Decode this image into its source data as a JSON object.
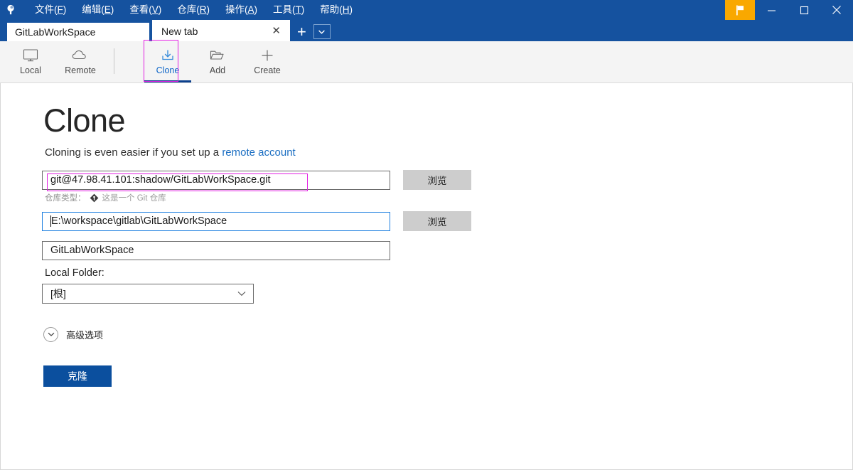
{
  "window": {
    "app_icon": "sourcetree-logo-icon",
    "flag_button_icon": "flag-icon",
    "minimize_label": "─",
    "maximize_label": "□",
    "close_label": "✕"
  },
  "menubar": {
    "items": [
      {
        "label": "文件(F)",
        "text": "文件",
        "accel": "F"
      },
      {
        "label": "编辑(E)",
        "text": "编辑",
        "accel": "E"
      },
      {
        "label": "查看(V)",
        "text": "查看",
        "accel": "V"
      },
      {
        "label": "仓库(R)",
        "text": "仓库",
        "accel": "R"
      },
      {
        "label": "操作(A)",
        "text": "操作",
        "accel": "A"
      },
      {
        "label": "工具(T)",
        "text": "工具",
        "accel": "T"
      },
      {
        "label": "帮助(H)",
        "text": "帮助",
        "accel": "H"
      }
    ]
  },
  "tabs": {
    "items": [
      {
        "label": "GitLabWorkSpace",
        "active": false
      },
      {
        "label": "New tab",
        "active": true,
        "close_label": "✕"
      }
    ],
    "new_tab_label": "+",
    "dropdown_icon": "chevron-down-icon"
  },
  "toolbar": {
    "buttons": [
      {
        "label": "Local",
        "icon": "monitor-icon",
        "active": false
      },
      {
        "label": "Remote",
        "icon": "cloud-icon",
        "active": false
      },
      {
        "label": "Clone",
        "icon": "clone-download-icon",
        "active": true,
        "highlighted": true
      },
      {
        "label": "Add",
        "icon": "folder-open-icon",
        "active": false
      },
      {
        "label": "Create",
        "icon": "plus-icon",
        "active": false
      }
    ]
  },
  "main": {
    "title": "Clone",
    "subtitle_prefix": "Cloning is even easier if you set up a ",
    "subtitle_link": "remote account",
    "source_url": {
      "value": "git@47.98.41.101:shadow/GitLabWorkSpace.git",
      "browse_label": "浏览",
      "highlighted": true
    },
    "repo_type": {
      "label": "仓库类型：",
      "icon": "git-diamond-icon",
      "value": "这是一个 Git 仓库"
    },
    "destination_path": {
      "value": "E:\\workspace\\gitlab\\GitLabWorkSpace",
      "browse_label": "浏览",
      "focused": true
    },
    "name_field": {
      "value": "GitLabWorkSpace"
    },
    "local_folder": {
      "label": "Local Folder:",
      "selected": "[根]",
      "chevron_icon": "chevron-down-icon"
    },
    "advanced_options": {
      "label": "高级选项",
      "icon": "chevron-down-circle-icon"
    },
    "clone_button": {
      "label": "克隆"
    }
  },
  "colors": {
    "titlebar": "#15529f",
    "accent_blue": "#0b4f9e",
    "flag_orange": "#f9a800",
    "link_blue": "#1b6ec2",
    "highlight_magenta": "#e220e2",
    "focus_blue": "#1d7fe0",
    "toolbar_bg": "#f4f4f4",
    "button_gray": "#cdcdcd"
  }
}
